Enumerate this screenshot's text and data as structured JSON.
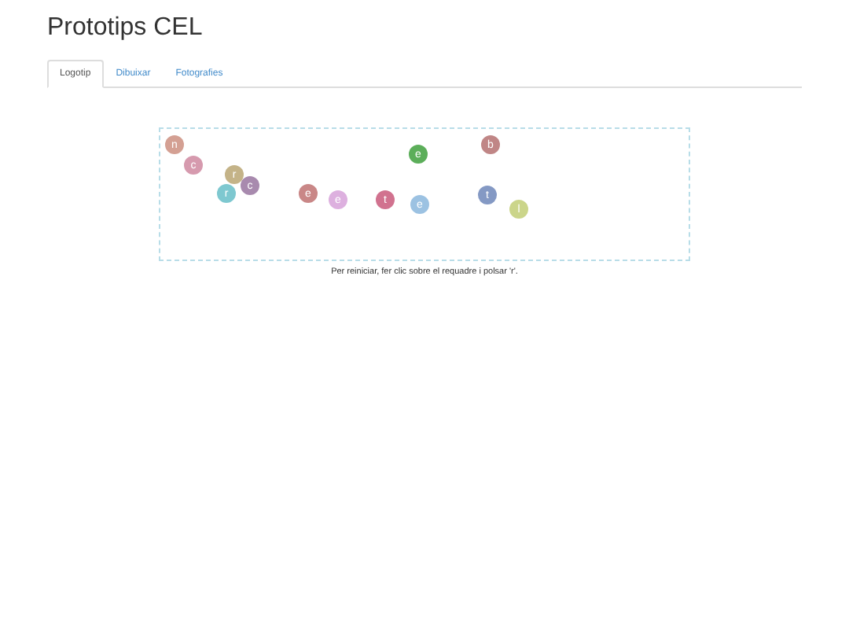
{
  "title": "Prototips CEL",
  "tabs": [
    {
      "label": "Logotip",
      "selected": true
    },
    {
      "label": "Dibuixar",
      "selected": false
    },
    {
      "label": "Fotografies",
      "selected": false
    }
  ],
  "balls": [
    {
      "letter": "n",
      "color": "#d4a093"
    },
    {
      "letter": "c",
      "color": "#d69aae"
    },
    {
      "letter": "r",
      "color": "#c4b388"
    },
    {
      "letter": "c",
      "color": "#a88aae"
    },
    {
      "letter": "r",
      "color": "#7ec8d0"
    },
    {
      "letter": "e",
      "color": "#c98787"
    },
    {
      "letter": "e",
      "color": "#ddb0df"
    },
    {
      "letter": "t",
      "color": "#d1728f"
    },
    {
      "letter": "e",
      "color": "#5cae5a"
    },
    {
      "letter": "e",
      "color": "#9cc2e2"
    },
    {
      "letter": "b",
      "color": "#c08686"
    },
    {
      "letter": "t",
      "color": "#8499c4"
    },
    {
      "letter": "l",
      "color": "#cbd58a"
    }
  ],
  "caption": "Per reiniciar, fer clic sobre el requadre i polsar 'r'."
}
